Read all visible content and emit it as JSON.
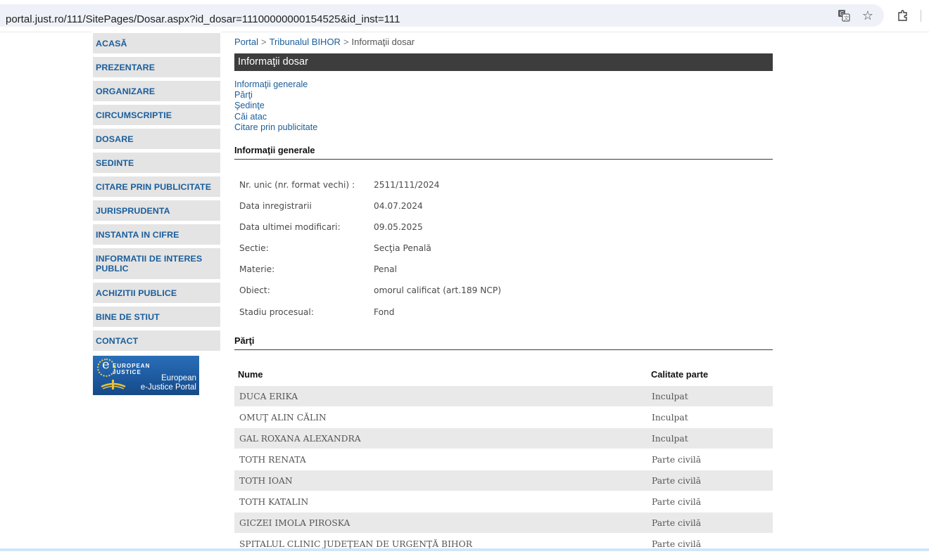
{
  "browser": {
    "url": "portal.just.ro/111/SitePages/Dosar.aspx?id_dosar=11100000000154525&id_inst=111",
    "icons": [
      "translate-icon",
      "star-icon",
      "extensions-icon"
    ]
  },
  "sidebar": {
    "items": [
      {
        "label": "ACASĂ"
      },
      {
        "label": "PREZENTARE"
      },
      {
        "label": "ORGANIZARE"
      },
      {
        "label": "CIRCUMSCRIPTIE"
      },
      {
        "label": "DOSARE"
      },
      {
        "label": "SEDINTE"
      },
      {
        "label": "CITARE PRIN PUBLICITATE"
      },
      {
        "label": "JURISPRUDENTA"
      },
      {
        "label": "INSTANTA IN CIFRE"
      },
      {
        "label": "INFORMATII DE INTERES PUBLIC"
      },
      {
        "label": "ACHIZITII PUBLICE"
      },
      {
        "label": "BINE DE STIUT"
      },
      {
        "label": "CONTACT"
      }
    ],
    "banner": {
      "logo_line1": "EUROPEAN",
      "logo_line2": "JUSTICE",
      "title_line1": "European",
      "title_line2": "e-Justice Portal"
    }
  },
  "breadcrumb": {
    "portal": "Portal",
    "sep": ">",
    "court": "Tribunalul BIHOR",
    "current": "Informaţii dosar"
  },
  "page_title": "Informaţii dosar",
  "section_links": [
    "Informaţii generale",
    "Părţi",
    "Şedinţe",
    "Căi atac",
    "Citare prin publicitate"
  ],
  "general": {
    "heading": "Informaţii generale",
    "rows": [
      {
        "label": "Nr. unic (nr. format vechi) :",
        "value": "2511/111/2024"
      },
      {
        "label": "Data inregistrarii",
        "value": "04.07.2024"
      },
      {
        "label": "Data ultimei modificari:",
        "value": "09.05.2025"
      },
      {
        "label": "Sectie:",
        "value": "Secţia Penală"
      },
      {
        "label": "Materie:",
        "value": "Penal"
      },
      {
        "label": "Obiect:",
        "value": "omorul calificat (art.189 NCP)"
      },
      {
        "label": "Stadiu procesual:",
        "value": "Fond"
      }
    ]
  },
  "parties": {
    "heading": "Părţi",
    "col_name": "Nume",
    "col_role": "Calitate parte",
    "rows": [
      {
        "name": "DUCA ERIKA",
        "role": "Inculpat"
      },
      {
        "name": "OMUŢ ALIN CĂLIN",
        "role": "Inculpat"
      },
      {
        "name": "GAL ROXANA ALEXANDRA",
        "role": "Inculpat"
      },
      {
        "name": "TOTH RENATA",
        "role": "Parte civilă"
      },
      {
        "name": "TOTH IOAN",
        "role": "Parte civilă"
      },
      {
        "name": "TOTH KATALIN",
        "role": "Parte civilă"
      },
      {
        "name": "GICZEI IMOLA PIROSKA",
        "role": "Parte civilă"
      },
      {
        "name": "SPITALUL CLINIC JUDEŢEAN DE URGENŢĂ BIHOR",
        "role": "Parte civilă"
      }
    ]
  }
}
